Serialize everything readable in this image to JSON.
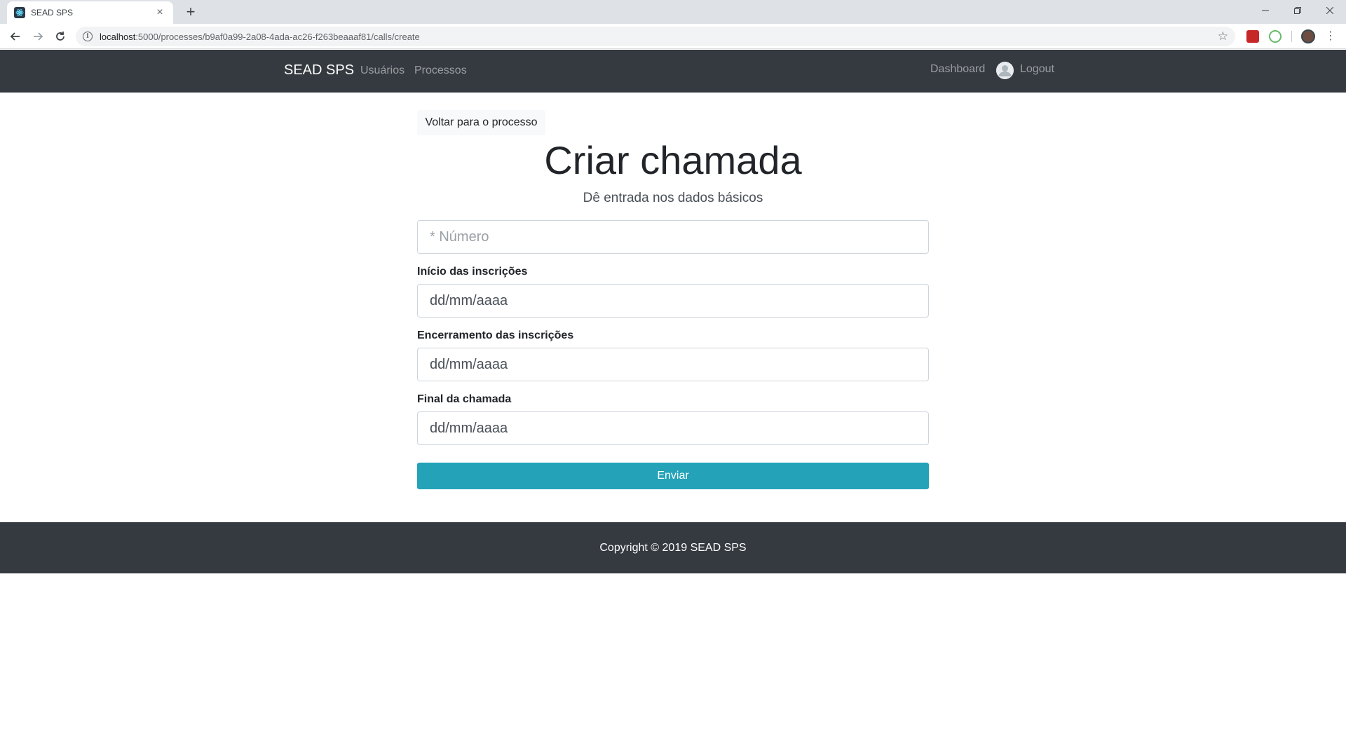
{
  "browser": {
    "tab_title": "SEAD SPS",
    "tab_close": "×",
    "new_tab": "+",
    "url_host": "localhost",
    "url_path": ":5000/processes/b9af0a99-2a08-4ada-ac26-f263beaaaf81/calls/create",
    "icons": [
      "back-arrow-icon",
      "forward-arrow-icon",
      "reload-icon",
      "info-icon",
      "star-icon",
      "extension-icon",
      "profile-avatar-icon",
      "menu-dots-icon"
    ]
  },
  "navbar": {
    "brand": "SEAD SPS",
    "links": [
      "Usuários",
      "Processos"
    ],
    "dashboard": "Dashboard",
    "logout": "Logout"
  },
  "main": {
    "back_button": "Voltar para o processo",
    "title": "Criar chamada",
    "subtitle": "Dê entrada nos dados básicos",
    "numero_placeholder": "* Número",
    "fields": [
      {
        "label": "Início das inscrições",
        "value": "dd/mm/aaaa"
      },
      {
        "label": "Encerramento das inscrições",
        "value": "dd/mm/aaaa"
      },
      {
        "label": "Final da chamada",
        "value": "dd/mm/aaaa"
      }
    ],
    "submit": "Enviar"
  },
  "footer": {
    "copyright": "Copyright © 2019 SEAD SPS"
  },
  "colors": {
    "navbar_bg": "#343a40",
    "submit_bg": "#23a2b8",
    "footer_bg": "#343a40"
  }
}
